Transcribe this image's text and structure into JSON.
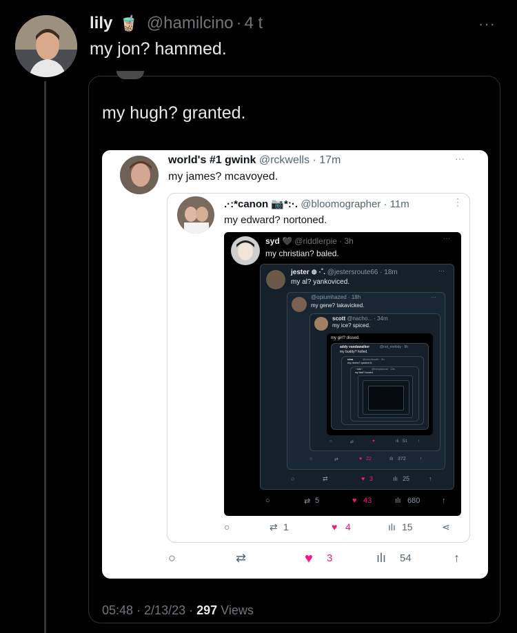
{
  "tweet": {
    "display_name": "lily",
    "emoji": "🧋",
    "handle": "@hamilcino",
    "sep": "·",
    "time": "4 t",
    "text": "my jon? hammed.",
    "more": "···"
  },
  "quote": {
    "text": "my hugh? granted."
  },
  "screenshot": {
    "top": {
      "name": "world's #1 gwink",
      "handle": "@rckwells · 17m",
      "text": "my james? mcavoyed.",
      "more": "···",
      "actions": {
        "reply": "",
        "retweet": "",
        "likes": "3",
        "views": "54",
        "share": ""
      }
    },
    "level2": {
      "name": ".·:*canon 📷*:·.",
      "handle": "@bloomographer · 11m",
      "text": "my edward? nortoned.",
      "more": "⋮",
      "actions": {
        "retweets": "1",
        "likes": "4",
        "views": "15"
      }
    },
    "level3": {
      "name": "syd 🖤",
      "handle": "@riddlerpie · 3h",
      "text": "my christian? baled.",
      "more": "···",
      "actions": {
        "retweets": "5",
        "likes": "43",
        "views": "680"
      }
    },
    "level4": {
      "name": "jester ⊕ ·˚.",
      "handle": "@jestersroute66 · 18m",
      "text": "my al? yankoviced.",
      "more": "···",
      "actions": {
        "likes": "3",
        "views": "25"
      }
    },
    "level5": {
      "handle": "@opiumhazed · 18h",
      "text": "my gene? takavicked.",
      "more": "···",
      "actions": {
        "likes": "22",
        "views": "372"
      }
    },
    "level6": {
      "name": "scott",
      "handle": "@nacho... · 34m",
      "text": "my ice? spiced.",
      "more": "⋮",
      "actions": {
        "views": "51"
      }
    },
    "level7": {
      "text": "my girl? dissed."
    },
    "level8": {
      "name": "addy vandawalker",
      "handle": "@not_melody · 9h",
      "text": "my buddy? holled."
    },
    "level9": {
      "name": "nina",
      "handle": "@cloudbooth · 5h",
      "text": "my rivers? quoted it."
    },
    "level10": {
      "name": "·:·tobi·:·",
      "handle": "@theoyliseman · 13m",
      "text": "my thief? busted."
    }
  },
  "footer": {
    "timestamp": "05:48 · 2/13/23 · ",
    "views_count": "297",
    "views_label": " Views"
  },
  "colors": {
    "like": "#f91880",
    "muted": "#71767b",
    "navy": "#15202b"
  }
}
